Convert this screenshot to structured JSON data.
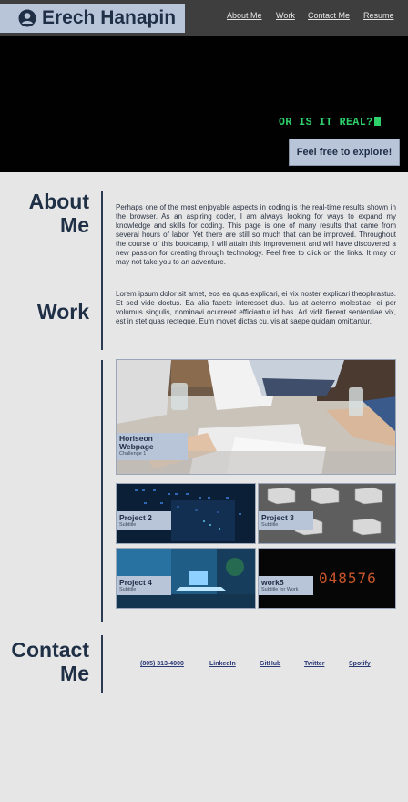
{
  "header": {
    "brand_name": "Erech Hanapin",
    "nav": [
      "About Me",
      "Work",
      "Contact Me",
      "Resume"
    ]
  },
  "hero": {
    "terminal_text": "OR IS IT REAL?",
    "cta_label": "Feel free to explore!"
  },
  "about": {
    "heading_line1": "About",
    "heading_line2": "Me",
    "paragraph1": "Perhaps one of the most enjoyable aspects in coding is the real-time results shown in the browser. As an aspiring coder, I am always looking for ways to expand my knowledge and skills for coding. This page is one of many results that came from several hours of labor. Yet there are still so much that can be improved. Throughout the course of this bootcamp, I will attain this improvement and will have discovered a new passion for creating through technology. Feel free to click on the links. It may or may not take you to an adventure.",
    "paragraph2": "Lorem ipsum dolor sit amet, eos ea quas explicari, ei vix noster explicari theophrastus. Et sed vide doctus. Ea alia facete interesset duo. Ius at aeterno molestiae, ei per volumus singulis, nominavi ocurreret efficiantur id has. Ad vidit fierent sententiae vix, est in stet quas recteque. Eum movet dictas cu, vis at saepe quidam omittantur."
  },
  "work": {
    "heading": "Work",
    "projects": [
      {
        "title": "Horiseon Webpage",
        "subtitle": "Challenge 1"
      },
      {
        "title": "Project 2",
        "subtitle": "Subtitle"
      },
      {
        "title": "Project 3",
        "subtitle": "Subtitle"
      },
      {
        "title": "Project 4",
        "subtitle": "Subtitle"
      },
      {
        "title": "work5",
        "subtitle": "Subtitle for Work"
      }
    ],
    "counter_digits": "048576"
  },
  "contact": {
    "heading_line1": "Contact",
    "heading_line2": "Me",
    "links": [
      "(805) 313-4000",
      "LinkedIn",
      "GitHub",
      "Twitter",
      "Spotify"
    ]
  },
  "colors": {
    "accent": "#b8c4d8",
    "header_bg": "#3e3e3e",
    "page_bg": "#e6e6e6",
    "heading": "#1f2f46",
    "terminal_green": "#2fd16a"
  }
}
